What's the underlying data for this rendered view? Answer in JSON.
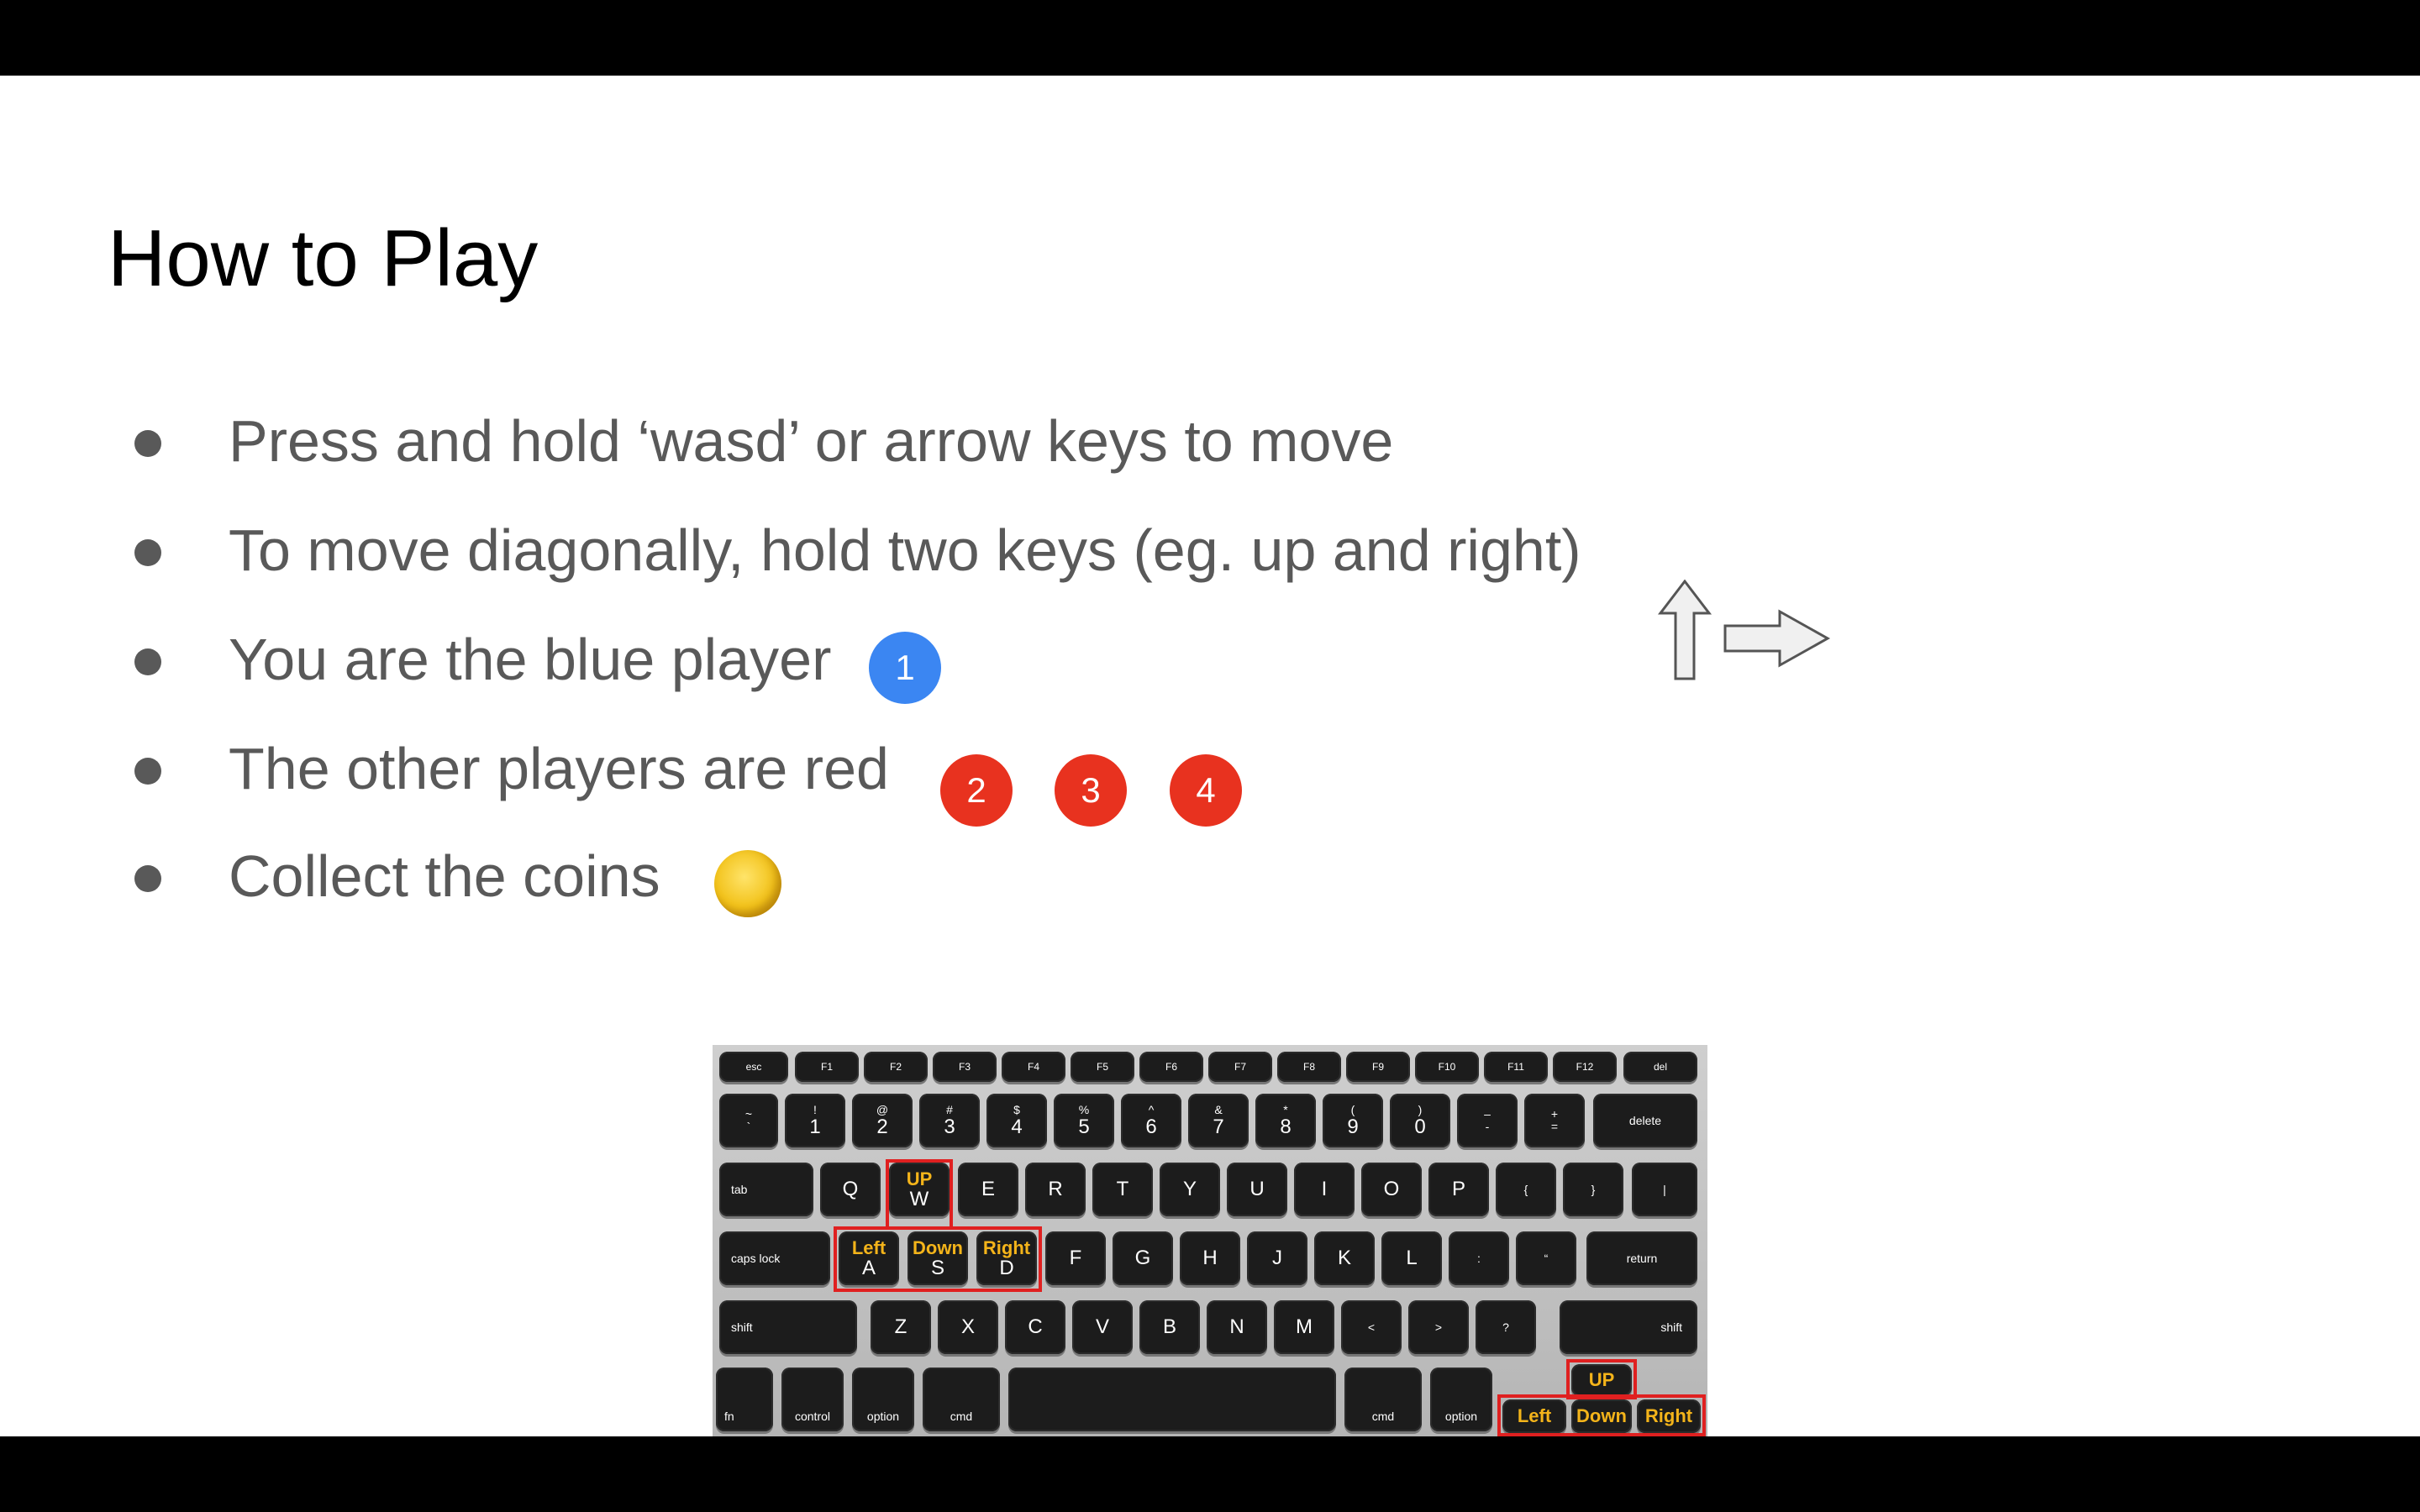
{
  "slide": {
    "title": "How to Play",
    "bullets": [
      "Press and hold ‘wasd’ or arrow keys to move",
      "To move diagonally, hold two keys (eg. up and right)",
      "You are the blue player",
      "The other players are red",
      "Collect the coins"
    ],
    "blue_player": "1",
    "red_players": [
      "2",
      "3",
      "4"
    ],
    "icons": [
      "arrow-up-icon",
      "arrow-right-icon",
      "coin-icon"
    ],
    "colors": {
      "blue_player": "#3b86f2",
      "red_player": "#e8321f",
      "coin": "#f2c21a",
      "highlight": "#e02020",
      "direction_text": "#f4b41a"
    }
  },
  "keyboard": {
    "function_row": [
      "esc",
      "F1",
      "F2",
      "F3",
      "F4",
      "F5",
      "F6",
      "F7",
      "F8",
      "F9",
      "F10",
      "F11",
      "F12",
      "del"
    ],
    "number_row": [
      "~",
      "!",
      "@",
      "#",
      "$",
      "%",
      "^",
      "&",
      "*",
      "(",
      ")",
      "–",
      "+",
      "delete"
    ],
    "number_row_lower": [
      "`",
      "1",
      "2",
      "3",
      "4",
      "5",
      "6",
      "7",
      "8",
      "9",
      "0",
      "-",
      "="
    ],
    "qwerty_row": [
      "tab",
      "Q",
      "W",
      "E",
      "R",
      "T",
      "Y",
      "U",
      "I",
      "O",
      "P",
      "{",
      "}",
      "|"
    ],
    "home_row": [
      "caps lock",
      "A",
      "S",
      "D",
      "F",
      "G",
      "H",
      "J",
      "K",
      "L",
      ":",
      "“",
      "return"
    ],
    "bottom_row": [
      "shift",
      "Z",
      "X",
      "C",
      "V",
      "B",
      "N",
      "M",
      "<",
      ">",
      "?",
      "shift"
    ],
    "modifier_row": [
      "fn",
      "control",
      "option",
      "cmd",
      "cmd",
      "option"
    ],
    "wasd_labels": {
      "w": "UP",
      "a": "Left",
      "s": "Down",
      "d": "Right"
    },
    "arrow_labels": {
      "up": "UP",
      "left": "Left",
      "down": "Down",
      "right": "Right"
    }
  }
}
